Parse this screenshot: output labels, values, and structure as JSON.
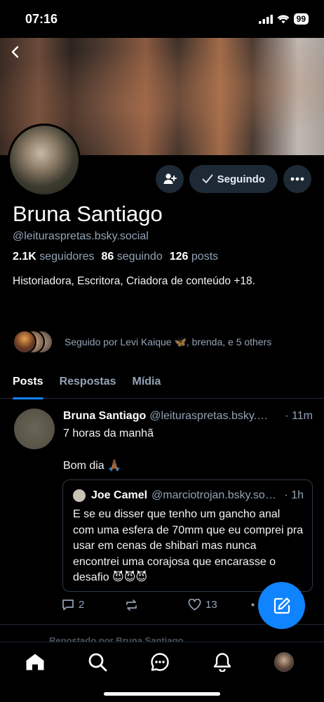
{
  "status_bar": {
    "time": "07:16",
    "battery": "99"
  },
  "profile": {
    "display_name": "Bruna Santiago",
    "handle": "@leituraspretas.bsky.social",
    "followers_count": "2.1K",
    "followers_label": "seguidores",
    "following_count": "86",
    "following_label": "seguindo",
    "posts_count": "126",
    "posts_label": "posts",
    "bio": "Historiadora, Escritora, Criadora de conteúdo +18.",
    "follow_button_label": "Seguindo",
    "followed_by_text": "Seguido por Levi Kaique 🦋, brenda, e 5 others"
  },
  "tabs": [
    {
      "label": "Posts",
      "active": true
    },
    {
      "label": "Respostas",
      "active": false
    },
    {
      "label": "Mídia",
      "active": false
    }
  ],
  "post": {
    "author": "Bruna Santiago",
    "handle": "@leituraspretas.bsky.…",
    "time": "· 11m",
    "text_line1": "7 horas da manhã",
    "text_line2": "Bom dia 🙏🏾",
    "quote": {
      "author": "Joe Camel",
      "handle": "@marciotrojan.bsky.so…",
      "time": "· 1h",
      "text": "E se eu disser que tenho um gancho anal com uma esfera de 70mm que eu comprei pra usar em cenas de shibari mas nunca encontrei uma corajosa que encarasse o desafio 😈😈😈"
    },
    "reply_count": "2",
    "repost_count": "",
    "like_count": "13"
  },
  "next_item_peek": "Repostado por Bruna Santiago",
  "colors": {
    "accent": "#1083fe",
    "muted": "#93a3b5",
    "button_bg": "#1e2936"
  },
  "icons": {
    "back": "chevron-left-icon",
    "add_user": "add-user-icon",
    "check": "check-icon",
    "more": "ellipsis-icon",
    "compose": "compose-icon",
    "nav": [
      "home-icon",
      "search-icon",
      "chat-icon",
      "bell-icon",
      "profile-avatar"
    ]
  }
}
